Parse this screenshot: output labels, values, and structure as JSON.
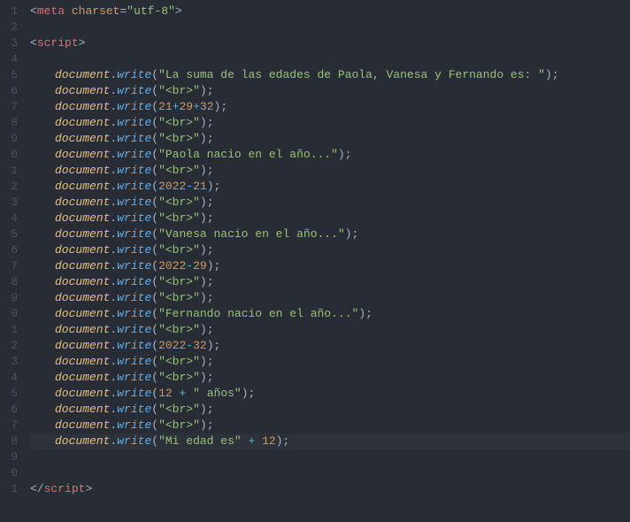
{
  "gutter": {
    "start_trunc": true,
    "lines": [
      "1",
      "2",
      "3",
      "4",
      "5",
      "6",
      "7",
      "8",
      "9",
      "0",
      "1",
      "2",
      "3",
      "4",
      "5",
      "6",
      "7",
      "8",
      "9",
      "0",
      "1",
      "2",
      "3",
      "4",
      "5",
      "6",
      "7",
      "8",
      "9",
      "0",
      "1"
    ]
  },
  "highlight_index": 27,
  "code": {
    "meta": {
      "tag": "meta",
      "attr": "charset",
      "val": "\"utf-8\""
    },
    "script_open": "script",
    "script_close": "script",
    "lines": [
      {
        "type": "str",
        "arg": "\"La suma de las edades de Paola, Vanesa y Fernando es: \""
      },
      {
        "type": "str",
        "arg": "\"<br>\""
      },
      {
        "type": "expr3",
        "a": "21",
        "op1": "+",
        "b": "29",
        "op2": "+",
        "c": "32"
      },
      {
        "type": "str",
        "arg": "\"<br>\""
      },
      {
        "type": "str",
        "arg": "\"<br>\""
      },
      {
        "type": "str",
        "arg": "\"Paola nacio en el año...\""
      },
      {
        "type": "str",
        "arg": "\"<br>\""
      },
      {
        "type": "expr2",
        "a": "2022",
        "op1": "-",
        "b": "21"
      },
      {
        "type": "str",
        "arg": "\"<br>\""
      },
      {
        "type": "str",
        "arg": "\"<br>\""
      },
      {
        "type": "str",
        "arg": "\"Vanesa nacio en el año...\""
      },
      {
        "type": "str",
        "arg": "\"<br>\""
      },
      {
        "type": "expr2",
        "a": "2022",
        "op1": "-",
        "b": "29"
      },
      {
        "type": "str",
        "arg": "\"<br>\""
      },
      {
        "type": "str",
        "arg": "\"<br>\""
      },
      {
        "type": "str",
        "arg": "\"Fernando nacio en el año...\""
      },
      {
        "type": "str",
        "arg": "\"<br>\""
      },
      {
        "type": "expr2",
        "a": "2022",
        "op1": "-",
        "b": "32"
      },
      {
        "type": "str",
        "arg": "\"<br>\""
      },
      {
        "type": "str",
        "arg": "\"<br>\""
      },
      {
        "type": "concat_num_str",
        "a": "12",
        "op1": "+",
        "b": "\" años\""
      },
      {
        "type": "str",
        "arg": "\"<br>\""
      },
      {
        "type": "str",
        "arg": "\"<br>\""
      },
      {
        "type": "concat_str_num",
        "a": "\"Mi edad es\"",
        "op1": "+",
        "b": "12"
      }
    ],
    "obj": "document",
    "method": "write",
    "dot": ".",
    "lp": "(",
    "rp": ")",
    "semi": ";",
    "lt": "<",
    "gt": ">",
    "slash": "/",
    "eq": "=",
    "sp": " "
  }
}
